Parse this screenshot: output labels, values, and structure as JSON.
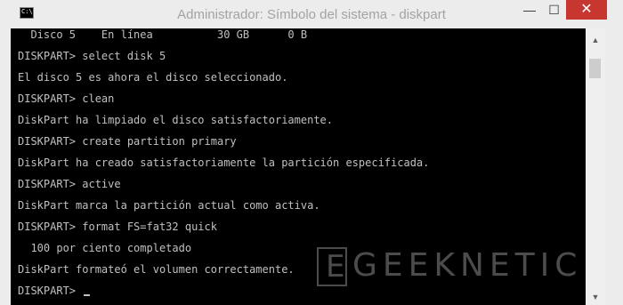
{
  "window": {
    "title": "Administrador: Símbolo del sistema - diskpart",
    "icon_label": "C:\\",
    "controls": {
      "minimize": "—",
      "maximize": "☐",
      "close": "✕"
    }
  },
  "console": {
    "lines": [
      "  Disco 5    En línea          30 GB      0 B",
      "DISKPART> select disk 5",
      "El disco 5 es ahora el disco seleccionado.",
      "DISKPART> clean",
      "DiskPart ha limpiado el disco satisfactoriamente.",
      "DISKPART> create partition primary",
      "DiskPart ha creado satisfactoriamente la partición especificada.",
      "DISKPART> active",
      "DiskPart marca la partición actual como activa.",
      "DISKPART> format FS=fat32 quick",
      "  100 por ciento completado",
      "DiskPart formateó el volumen correctamente.",
      "DISKPART> "
    ]
  },
  "scrollbar": {
    "up_arrow": "▲",
    "down_arrow": "▼"
  },
  "watermark": {
    "mark": "E",
    "text": "GEEKNETIC"
  },
  "colors": {
    "console_bg": "#000000",
    "console_text": "#c0c0c0",
    "close_button": "#c7372f"
  }
}
